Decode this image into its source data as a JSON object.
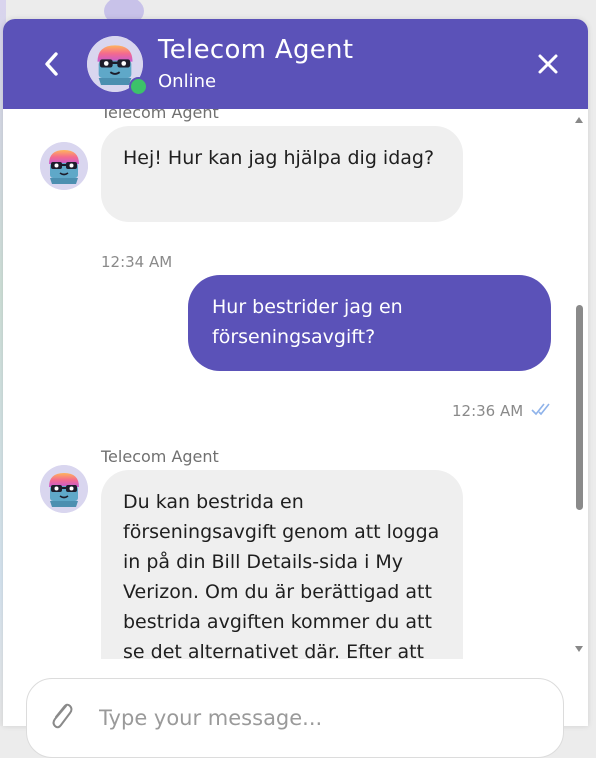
{
  "header": {
    "title": "Telecom Agent",
    "status": "Online",
    "back_icon": "chevron-left-icon",
    "close_icon": "close-icon"
  },
  "messages": [
    {
      "type": "agent",
      "sender": "Telecom Agent",
      "text": "Hej! Hur kan jag hjälpa dig idag?",
      "time": "12:34 AM"
    },
    {
      "type": "user",
      "text": "Hur bestrider jag en förseningsavgift?",
      "time": "12:36 AM",
      "read_icon": "double-check-icon"
    },
    {
      "type": "agent",
      "sender": "Telecom Agent",
      "text": "Du kan bestrida en förseningsavgift genom att logga in på din Bill Details-sida i My Verizon. Om du är berättigad att bestrida avgiften kommer du att se det alternativet där. Efter att du har"
    }
  ],
  "composer": {
    "placeholder": "Type your message...",
    "attach_icon": "paperclip-icon"
  },
  "colors": {
    "brand": "#5b52b8",
    "agent_bubble": "#efefef",
    "online": "#3cc26a",
    "read_check": "#8fb3ea"
  }
}
